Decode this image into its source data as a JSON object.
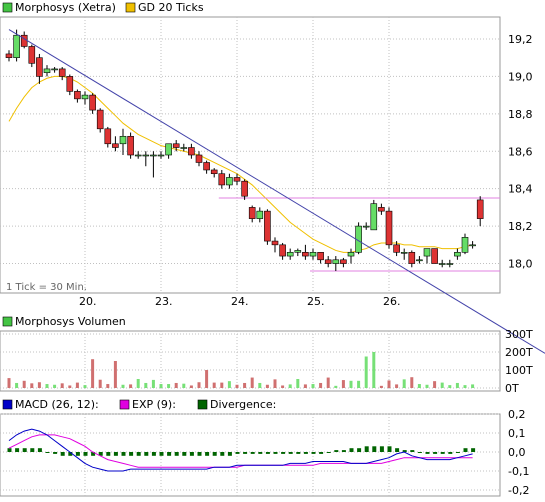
{
  "legend_top": {
    "series1": {
      "label": "Morphosys (Xetra)",
      "color": "#44c444"
    },
    "series2": {
      "label": "GD 20 Ticks",
      "color": "#f0c000"
    }
  },
  "tick_note": "1 Tick = 30 Min.",
  "x_labels": [
    "20.",
    "23.",
    "24.",
    "25.",
    "26."
  ],
  "volume_title": {
    "label": "Morphosys Volumen",
    "color": "#44c444"
  },
  "macd_legend": {
    "macd": {
      "label": "MACD (26, 12):",
      "color": "#0000c8"
    },
    "exp": {
      "label": "EXP (9):",
      "color": "#e000e0"
    },
    "div": {
      "label": "Divergence:",
      "color": "#006400"
    }
  },
  "colors": {
    "up": "#66dd66",
    "down": "#dd3333",
    "grid": "#c0c0c0",
    "trend": "#4444aa",
    "hline": "#e080e0"
  },
  "chart_data": [
    {
      "type": "candlestick",
      "title": "Morphosys (Xetra)",
      "ylim": [
        17.88,
        19.28
      ],
      "y_ticks": [
        "19,2",
        "19,0",
        "18,8",
        "18,6",
        "18,4",
        "18,2",
        "18,0"
      ],
      "y_tick_values": [
        19.2,
        19.0,
        18.8,
        18.6,
        18.4,
        18.2,
        18.0
      ],
      "x_categories": [
        "20.",
        "23.",
        "24.",
        "25.",
        "26."
      ],
      "x_category_index": [
        10,
        20,
        30,
        40,
        50
      ],
      "candles": [
        [
          19.12,
          19.14,
          19.08,
          19.1
        ],
        [
          19.1,
          19.25,
          19.08,
          19.22
        ],
        [
          19.22,
          19.24,
          19.15,
          19.16
        ],
        [
          19.16,
          19.17,
          19.05,
          19.07
        ],
        [
          19.1,
          19.12,
          18.96,
          19.0
        ],
        [
          19.02,
          19.06,
          19.0,
          19.04
        ],
        [
          19.04,
          19.05,
          19.02,
          19.04
        ],
        [
          19.04,
          19.05,
          18.98,
          19.0
        ],
        [
          19.0,
          19.01,
          18.9,
          18.92
        ],
        [
          18.92,
          18.93,
          18.86,
          18.88
        ],
        [
          18.88,
          18.92,
          18.85,
          18.9
        ],
        [
          18.9,
          18.91,
          18.8,
          18.82
        ],
        [
          18.82,
          18.83,
          18.7,
          18.72
        ],
        [
          18.72,
          18.73,
          18.62,
          18.64
        ],
        [
          18.64,
          18.68,
          18.6,
          18.62
        ],
        [
          18.64,
          18.72,
          18.58,
          18.68
        ],
        [
          18.68,
          18.7,
          18.56,
          18.58
        ],
        [
          18.58,
          18.6,
          18.56,
          18.58
        ],
        [
          18.58,
          18.6,
          18.52,
          18.58
        ],
        [
          18.58,
          18.6,
          18.46,
          18.58
        ],
        [
          18.58,
          18.6,
          18.56,
          18.58
        ],
        [
          18.58,
          18.64,
          18.56,
          18.64
        ],
        [
          18.64,
          18.66,
          18.6,
          18.62
        ],
        [
          18.62,
          18.64,
          18.6,
          18.62
        ],
        [
          18.62,
          18.64,
          18.56,
          18.58
        ],
        [
          18.58,
          18.6,
          18.52,
          18.54
        ],
        [
          18.54,
          18.55,
          18.48,
          18.5
        ],
        [
          18.5,
          18.51,
          18.46,
          18.48
        ],
        [
          18.48,
          18.5,
          18.4,
          18.42
        ],
        [
          18.42,
          18.48,
          18.4,
          18.46
        ],
        [
          18.46,
          18.48,
          18.42,
          18.44
        ],
        [
          18.44,
          18.45,
          18.34,
          18.36
        ],
        [
          18.3,
          18.31,
          18.22,
          18.24
        ],
        [
          18.24,
          18.3,
          18.22,
          18.28
        ],
        [
          18.28,
          18.29,
          18.1,
          18.12
        ],
        [
          18.12,
          18.14,
          18.06,
          18.1
        ],
        [
          18.1,
          18.11,
          18.02,
          18.04
        ],
        [
          18.04,
          18.08,
          18.02,
          18.06
        ],
        [
          18.06,
          18.08,
          18.04,
          18.07
        ],
        [
          18.06,
          18.1,
          18.02,
          18.04
        ],
        [
          18.04,
          18.08,
          18.02,
          18.06
        ],
        [
          18.06,
          18.06,
          18.0,
          18.02
        ],
        [
          18.02,
          18.04,
          17.98,
          18.0
        ],
        [
          18.0,
          18.04,
          17.96,
          18.02
        ],
        [
          18.02,
          18.03,
          17.98,
          18.0
        ],
        [
          18.04,
          18.08,
          18.0,
          18.06
        ],
        [
          18.06,
          18.22,
          18.05,
          18.2
        ],
        [
          18.2,
          18.22,
          18.18,
          18.2
        ],
        [
          18.18,
          18.34,
          18.18,
          18.32
        ],
        [
          18.3,
          18.32,
          18.26,
          18.28
        ],
        [
          18.28,
          18.3,
          18.08,
          18.1
        ],
        [
          18.1,
          18.12,
          18.04,
          18.06
        ],
        [
          18.06,
          18.08,
          18.02,
          18.06
        ],
        [
          18.06,
          18.07,
          17.98,
          18.0
        ],
        [
          18.02,
          18.04,
          18.0,
          18.02
        ],
        [
          18.04,
          18.08,
          18.0,
          18.08
        ],
        [
          18.08,
          18.08,
          18.0,
          18.0
        ],
        [
          18.0,
          18.02,
          17.98,
          18.0
        ],
        [
          18.0,
          18.02,
          17.98,
          18.0
        ],
        [
          18.04,
          18.08,
          18.02,
          18.06
        ],
        [
          18.06,
          18.16,
          18.05,
          18.14
        ],
        [
          18.1,
          18.12,
          18.08,
          18.1
        ],
        [
          18.34,
          18.36,
          18.2,
          18.24
        ]
      ],
      "ma": [
        18.76,
        18.83,
        18.89,
        18.94,
        18.97,
        18.99,
        19.0,
        19.0,
        18.99,
        18.97,
        18.94,
        18.91,
        18.87,
        18.83,
        18.79,
        18.75,
        18.72,
        18.69,
        18.67,
        18.65,
        18.63,
        18.62,
        18.61,
        18.6,
        18.59,
        18.58,
        18.56,
        18.54,
        18.52,
        18.5,
        18.48,
        18.45,
        18.42,
        18.38,
        18.34,
        18.3,
        18.26,
        18.22,
        18.19,
        18.16,
        18.13,
        18.11,
        18.09,
        18.07,
        18.06,
        18.06,
        18.07,
        18.08,
        18.1,
        18.11,
        18.11,
        18.11,
        18.1,
        18.1,
        18.09,
        18.09,
        18.09,
        18.08,
        18.08,
        18.08,
        18.09,
        18.1
      ],
      "trendline": [
        [
          0,
          19.25
        ],
        [
          66,
          17.52
        ]
      ],
      "hlines": [
        18.35,
        17.96
      ]
    },
    {
      "type": "bar",
      "title": "Morphosys Volumen",
      "ylim": [
        0,
        300
      ],
      "y_ticks": [
        "300T",
        "200T",
        "100T",
        "0T"
      ],
      "y_tick_values": [
        300,
        200,
        100,
        0
      ],
      "volumes": [
        55,
        28,
        40,
        26,
        32,
        22,
        18,
        26,
        14,
        30,
        16,
        160,
        46,
        22,
        150,
        18,
        20,
        50,
        28,
        45,
        22,
        22,
        28,
        24,
        14,
        32,
        100,
        30,
        30,
        38,
        18,
        28,
        58,
        28,
        18,
        48,
        14,
        20,
        50,
        20,
        22,
        28,
        58,
        12,
        44,
        40,
        40,
        175,
        200,
        12,
        42,
        20,
        48,
        60,
        22,
        18,
        38,
        30,
        16,
        28,
        16,
        20
      ]
    },
    {
      "type": "line",
      "title": "MACD (26, 12)",
      "ylim": [
        -0.2,
        0.2
      ],
      "y_ticks": [
        "0,2",
        "0,1",
        "0,0",
        "-0,1",
        "-0,2"
      ],
      "y_tick_values": [
        0.2,
        0.1,
        0.0,
        -0.1,
        -0.2
      ],
      "series": [
        {
          "name": "MACD (26, 12)",
          "values": [
            0.06,
            0.09,
            0.11,
            0.12,
            0.11,
            0.09,
            0.06,
            0.03,
            0.0,
            -0.03,
            -0.06,
            -0.08,
            -0.09,
            -0.1,
            -0.1,
            -0.1,
            -0.09,
            -0.09,
            -0.09,
            -0.09,
            -0.09,
            -0.09,
            -0.09,
            -0.09,
            -0.09,
            -0.09,
            -0.09,
            -0.08,
            -0.08,
            -0.08,
            -0.07,
            -0.07,
            -0.07,
            -0.07,
            -0.07,
            -0.07,
            -0.07,
            -0.06,
            -0.06,
            -0.06,
            -0.05,
            -0.05,
            -0.05,
            -0.05,
            -0.05,
            -0.06,
            -0.06,
            -0.06,
            -0.05,
            -0.04,
            -0.03,
            -0.01,
            0.0,
            -0.02,
            -0.03,
            -0.04,
            -0.04,
            -0.04,
            -0.04,
            -0.03,
            -0.02,
            -0.01
          ]
        },
        {
          "name": "EXP (9)",
          "values": [
            0.02,
            0.04,
            0.06,
            0.08,
            0.09,
            0.09,
            0.09,
            0.08,
            0.07,
            0.05,
            0.03,
            0.0,
            -0.02,
            -0.04,
            -0.05,
            -0.06,
            -0.07,
            -0.08,
            -0.08,
            -0.08,
            -0.08,
            -0.08,
            -0.08,
            -0.08,
            -0.08,
            -0.08,
            -0.08,
            -0.08,
            -0.08,
            -0.08,
            -0.08,
            -0.07,
            -0.07,
            -0.07,
            -0.07,
            -0.07,
            -0.07,
            -0.07,
            -0.07,
            -0.07,
            -0.07,
            -0.06,
            -0.06,
            -0.06,
            -0.06,
            -0.06,
            -0.06,
            -0.06,
            -0.06,
            -0.06,
            -0.05,
            -0.04,
            -0.03,
            -0.03,
            -0.03,
            -0.03,
            -0.03,
            -0.03,
            -0.03,
            -0.03,
            -0.03,
            -0.03
          ]
        },
        {
          "name": "Divergence",
          "values": [
            0.02,
            0.02,
            0.02,
            0.02,
            0.02,
            0.0,
            -0.01,
            -0.02,
            -0.02,
            -0.02,
            -0.02,
            -0.02,
            -0.02,
            -0.02,
            -0.02,
            -0.02,
            -0.02,
            -0.02,
            -0.02,
            -0.02,
            -0.02,
            -0.02,
            -0.02,
            -0.02,
            -0.02,
            -0.02,
            -0.02,
            -0.02,
            -0.02,
            -0.02,
            -0.01,
            -0.01,
            -0.01,
            -0.01,
            -0.01,
            -0.01,
            -0.01,
            -0.01,
            -0.01,
            -0.01,
            -0.01,
            -0.01,
            0.0,
            0.01,
            0.01,
            0.02,
            0.02,
            0.03,
            0.03,
            0.03,
            0.03,
            0.02,
            0.01,
            0.01,
            0.0,
            -0.01,
            -0.01,
            -0.01,
            -0.01,
            0.0,
            0.02,
            0.02
          ]
        }
      ]
    }
  ]
}
